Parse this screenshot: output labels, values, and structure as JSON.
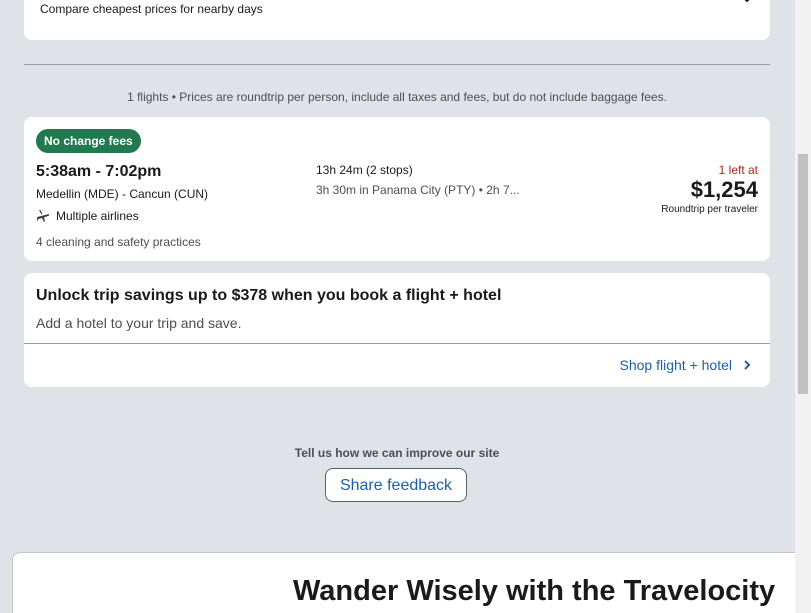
{
  "compare": {
    "text": "Compare cheapest prices for nearby days",
    "icon": "chevron-down-icon"
  },
  "results_info": "1 flights • Prices are roundtrip per person, include all taxes and fees, but do not include baggage fees.",
  "flight": {
    "badge": "No change fees",
    "times": "5:38am - 7:02pm",
    "route": "Medellin (MDE) - Cancun (CUN)",
    "airlines": "Multiple airlines",
    "airlines_icon": "multiple-airlines-icon",
    "safety": "4 cleaning and safety practices",
    "duration": "13h 24m (2 stops)",
    "layover": "3h 30m in Panama City (PTY) • 2h 7...",
    "seats_left": "1 left at",
    "price": "$1,254",
    "price_note": "Roundtrip per traveler",
    "badge_color": "#227950",
    "seats_color": "#b3261e"
  },
  "bundle": {
    "title": "Unlock trip savings up to $378 when you book a flight + hotel",
    "subtitle": "Add a hotel to your trip and save.",
    "link": "Shop flight + hotel",
    "link_icon": "chevron-right-icon",
    "link_color": "#1f5fa8"
  },
  "feedback": {
    "prompt": "Tell us how we can improve our site",
    "button": "Share feedback"
  },
  "promo": {
    "title": "Wander Wisely with the Travelocity"
  }
}
